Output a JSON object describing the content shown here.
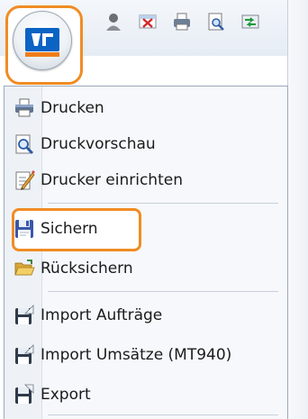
{
  "menu": {
    "items": [
      {
        "label": "Drucken",
        "icon": "printer-icon"
      },
      {
        "label": "Druckvorschau",
        "icon": "print-preview-icon"
      },
      {
        "label": "Drucker einrichten",
        "icon": "printer-setup-icon"
      },
      {
        "label": "Sichern",
        "icon": "floppy-disk-icon"
      },
      {
        "label": "Rücksichern",
        "icon": "folder-open-icon"
      },
      {
        "label": "Import Aufträge",
        "icon": "import-icon"
      },
      {
        "label": "Import Umsätze (MT940)",
        "icon": "import-icon"
      },
      {
        "label": "Export",
        "icon": "export-icon"
      }
    ]
  },
  "toolbar": {
    "icons": [
      "user-icon",
      "delete-icon",
      "printer-icon",
      "print-preview-icon",
      "transfer-icon"
    ]
  },
  "colors": {
    "highlight": "#f08c24",
    "logo_blue": "#0b63c4",
    "logo_orange": "#f07d1a"
  }
}
